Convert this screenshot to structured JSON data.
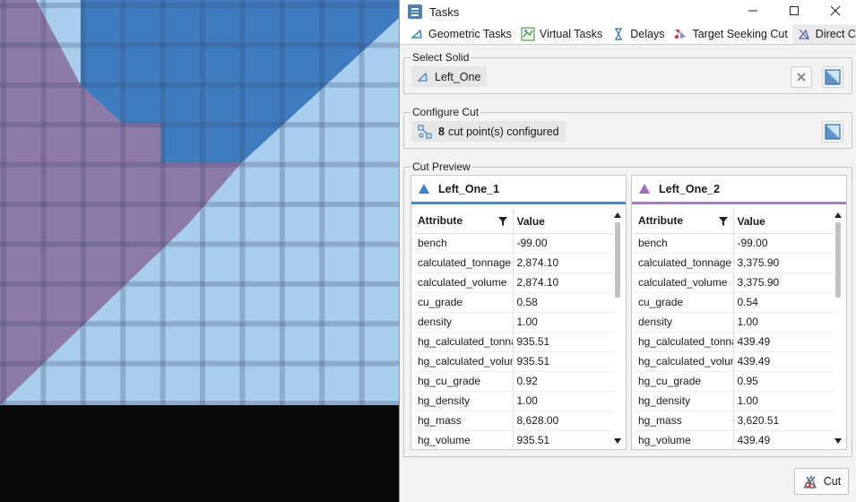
{
  "window": {
    "title": "Tasks",
    "controls": {
      "minimize": "—",
      "maximize": "☐",
      "close": "✕"
    }
  },
  "tabs": [
    {
      "label": "Geometric Tasks",
      "icon": "geometric-tasks-icon"
    },
    {
      "label": "Virtual Tasks",
      "icon": "virtual-tasks-icon"
    },
    {
      "label": "Delays",
      "icon": "hourglass-icon"
    },
    {
      "label": "Target Seeking Cut",
      "icon": "target-seeking-icon"
    },
    {
      "label": "Direct Cut",
      "icon": "direct-cut-icon",
      "active": true
    }
  ],
  "select_solid": {
    "label": "Select Solid",
    "value": "Left_One"
  },
  "configure_cut": {
    "label": "Configure Cut",
    "count": "8",
    "text": "cut point(s) configured"
  },
  "cut_preview": {
    "label": "Cut Preview",
    "columns": {
      "attribute": "Attribute",
      "value": "Value"
    },
    "panels": [
      {
        "title": "Left_One_1",
        "color": "#3b7fd1",
        "rows": [
          [
            "bench",
            "-99.00"
          ],
          [
            "calculated_tonnage",
            "2,874.10"
          ],
          [
            "calculated_volume",
            "2,874.10"
          ],
          [
            "cu_grade",
            "0.58"
          ],
          [
            "density",
            "1.00"
          ],
          [
            "hg_calculated_tonnage",
            "935.51"
          ],
          [
            "hg_calculated_volume",
            "935.51"
          ],
          [
            "hg_cu_grade",
            "0.92"
          ],
          [
            "hg_density",
            "1.00"
          ],
          [
            "hg_mass",
            "8,628.00"
          ],
          [
            "hg_volume",
            "935.51"
          ]
        ]
      },
      {
        "title": "Left_One_2",
        "color": "#9b6fc6",
        "rows": [
          [
            "bench",
            "-99.00"
          ],
          [
            "calculated_tonnage",
            "3,375.90"
          ],
          [
            "calculated_volume",
            "3,375.90"
          ],
          [
            "cu_grade",
            "0.54"
          ],
          [
            "density",
            "1.00"
          ],
          [
            "hg_calculated_tonnage",
            "439.49"
          ],
          [
            "hg_calculated_volume",
            "439.49"
          ],
          [
            "hg_cu_grade",
            "0.95"
          ],
          [
            "hg_density",
            "1.00"
          ],
          [
            "hg_mass",
            "3,620.51"
          ],
          [
            "hg_volume",
            "439.49"
          ]
        ]
      }
    ]
  },
  "actions": {
    "cut_label": "Cut"
  },
  "colors": {
    "accent_blue": "#3b7fd1",
    "accent_purple": "#9b6fc6",
    "block_light": "#acd2f0",
    "block_dark": "#3d7ec2",
    "block_purple": "#8a78a8"
  }
}
